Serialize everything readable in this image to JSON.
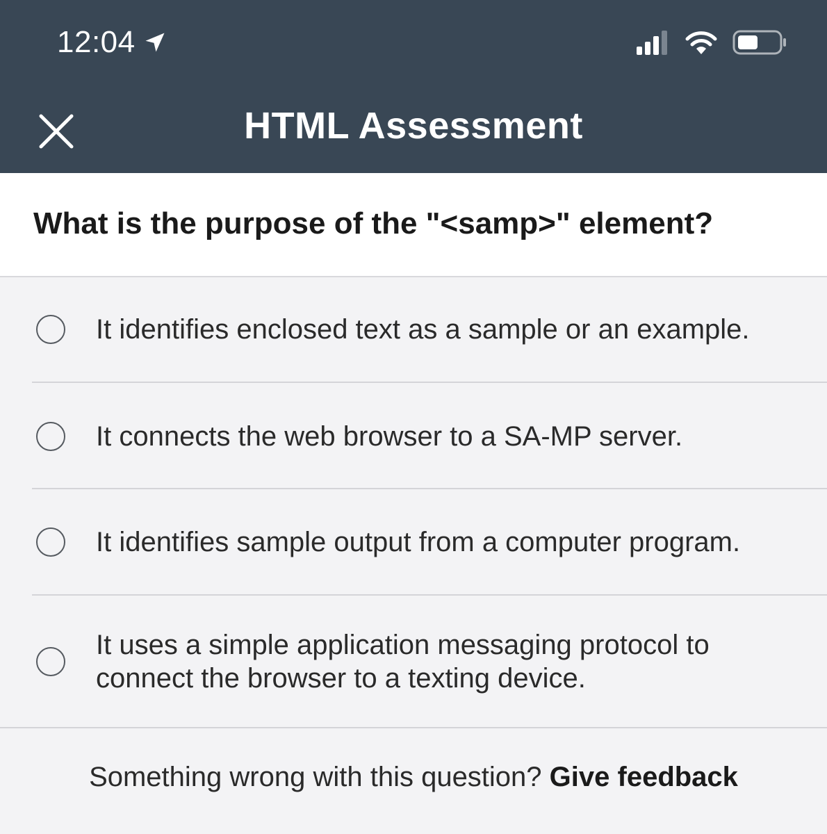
{
  "status_bar": {
    "time": "12:04",
    "icons": [
      "location-arrow-icon",
      "signal-icon",
      "wifi-icon",
      "battery-icon"
    ]
  },
  "nav": {
    "title": "HTML Assessment",
    "close_icon": "close-icon"
  },
  "question": {
    "text": "What is the purpose of the \"<samp>\" element?"
  },
  "options": [
    {
      "label": "It identifies enclosed text as a sample or an example.",
      "selected": false
    },
    {
      "label": "It connects the web browser to a SA-MP server.",
      "selected": false
    },
    {
      "label": "It identifies sample output from a computer program.",
      "selected": false
    },
    {
      "label_line1": "It uses a simple application messaging protocol to",
      "label_line2": "connect the browser to a texting device.",
      "selected": false
    }
  ],
  "footer": {
    "prompt": "Something wrong with this question?",
    "link": "Give feedback"
  },
  "colors": {
    "header_bg": "#394755",
    "page_bg": "#f3f3f5",
    "question_bg": "#ffffff"
  }
}
